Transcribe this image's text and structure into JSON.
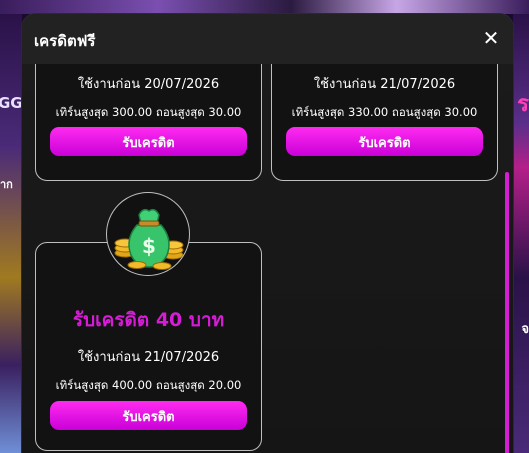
{
  "modal": {
    "title": "เครดิตฟรี",
    "close_label": "✕"
  },
  "cards": [
    {
      "expiry": "ใช้งานก่อน 20/07/2026",
      "limits": "เทิร์นสูงสุด 300.00  ถอนสูงสุด 30.00",
      "button": "รับเครดิต"
    },
    {
      "expiry": "ใช้งานก่อน 21/07/2026",
      "limits": "เทิร์นสูงสุด 330.00  ถอนสูงสุด 30.00",
      "button": "รับเครดิต"
    },
    {
      "name": "รับเครดิต 40 บาท",
      "expiry": "ใช้งานก่อน 21/07/2026",
      "limits": "เทิร์นสูงสุด 400.00  ถอนสูงสุด 20.00",
      "button": "รับเครดิต",
      "icon": "money-bag-icon"
    }
  ],
  "background": {
    "left_label_1": "GG",
    "left_label_2": "าก",
    "right_label_1": "ร",
    "right_label_2": "จ"
  },
  "colors": {
    "accent": "#d61cd6",
    "button_top": "#ff2bf0",
    "button_bottom": "#c900d8",
    "modal_bg": "#161616"
  }
}
